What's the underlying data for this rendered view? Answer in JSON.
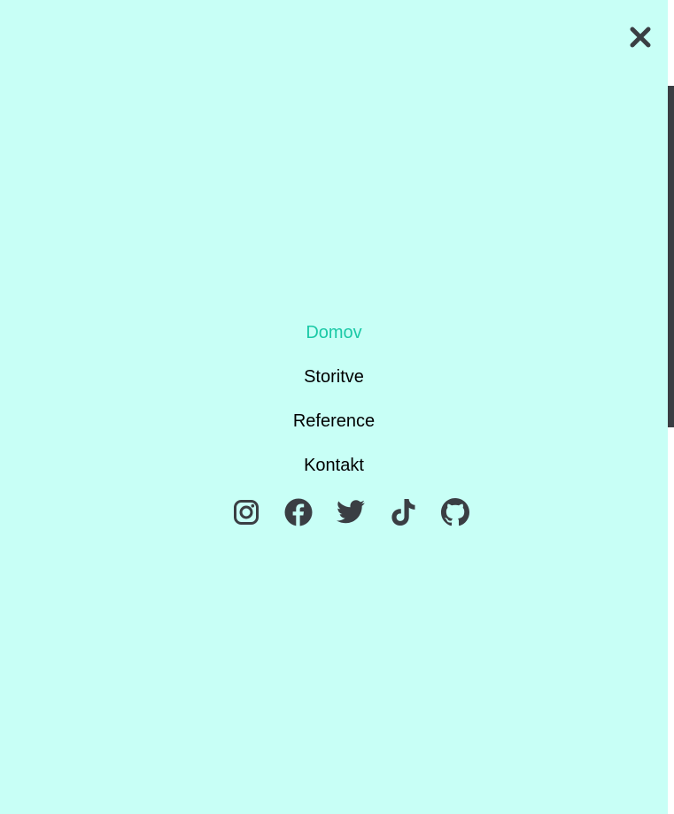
{
  "colors": {
    "background": "#c8fff6",
    "active_link": "#1bc9a6",
    "link": "#000000",
    "icon": "#3a3e43",
    "scrollbar_track": "#ffffff",
    "scrollbar_thumb": "#3a3e43"
  },
  "header": {
    "close_icon": "close-icon"
  },
  "nav": {
    "items": [
      {
        "label": "Domov",
        "active": true
      },
      {
        "label": "Storitve",
        "active": false
      },
      {
        "label": "Reference",
        "active": false
      },
      {
        "label": "Kontakt",
        "active": false
      }
    ]
  },
  "social": {
    "icons": [
      "instagram-icon",
      "facebook-icon",
      "twitter-icon",
      "tiktok-icon",
      "github-icon"
    ]
  }
}
